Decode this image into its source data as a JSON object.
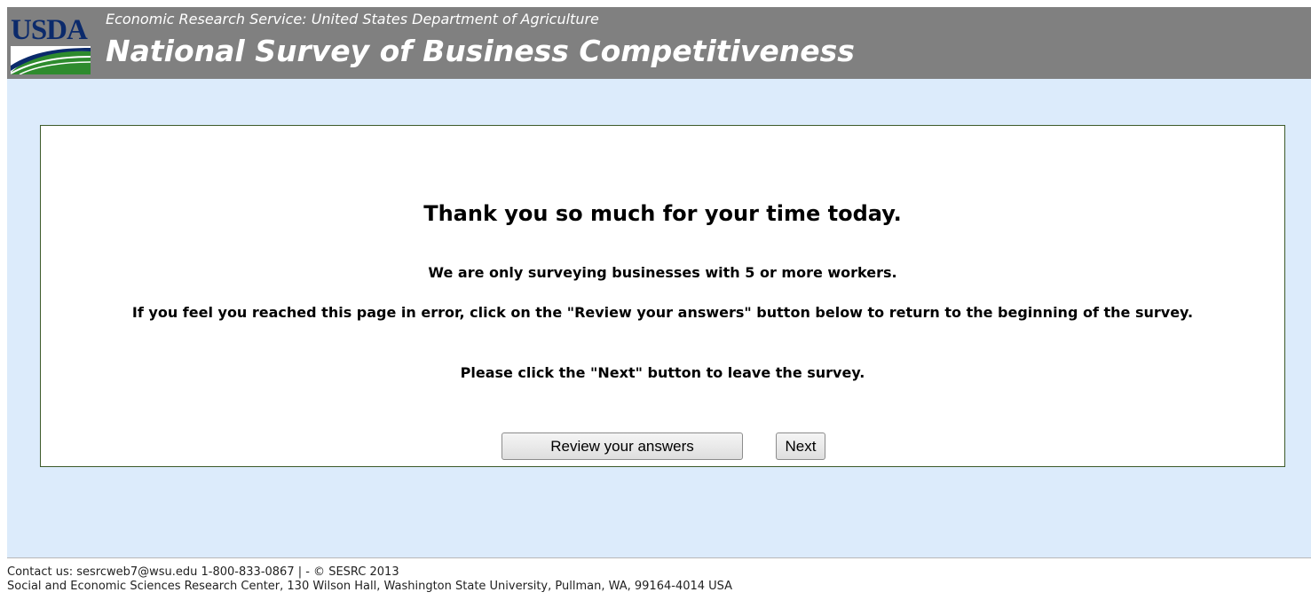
{
  "header": {
    "logo_text": "USDA",
    "subtitle": "Economic Research Service: United States Department of Agriculture",
    "title": "National Survey of Business Competitiveness"
  },
  "message": {
    "heading": "Thank you so much for your time today.",
    "line1": "We are only surveying businesses with 5 or more workers.",
    "line2": "If you feel you reached this page in error, click on the \"Review your answers\" button below to return to the beginning of the survey.",
    "line3": "Please click the \"Next\" button to leave the survey."
  },
  "buttons": {
    "review_label": "Review your answers",
    "next_label": "Next"
  },
  "footer": {
    "contact": "Contact us: sesrcweb7@wsu.edu 1-800-833-0867 | - © SESRC 2013",
    "address": "Social and Economic Sciences Research Center, 130 Wilson Hall, Washington State University, Pullman, WA, 99164-4014 USA"
  },
  "colors": {
    "header_bg": "#808080",
    "content_bg": "#dcebfb",
    "logo_blue": "#0b2a6b",
    "logo_green": "#2e8b2e",
    "box_border": "#3d5a2a"
  }
}
